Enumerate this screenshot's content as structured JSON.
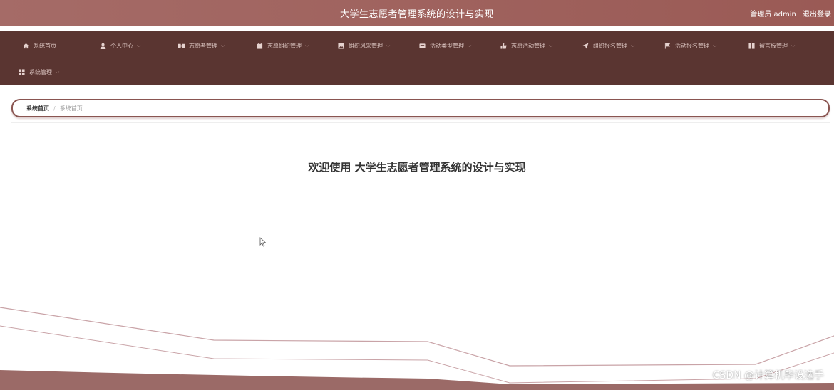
{
  "header": {
    "title": "大学生志愿者管理系统的设计与实现",
    "user_label": "管理员 admin",
    "logout_label": "退出登录"
  },
  "nav": {
    "items": [
      {
        "label": "系统首页",
        "icon": "home-icon",
        "has_dropdown": false
      },
      {
        "label": "个人中心",
        "icon": "user-icon",
        "has_dropdown": true
      },
      {
        "label": "志愿者管理",
        "icon": "group-icon",
        "has_dropdown": true
      },
      {
        "label": "志愿组织管理",
        "icon": "calendar-icon",
        "has_dropdown": true
      },
      {
        "label": "组织风采管理",
        "icon": "image-icon",
        "has_dropdown": true
      },
      {
        "label": "活动类型管理",
        "icon": "card-icon",
        "has_dropdown": true
      },
      {
        "label": "志愿活动管理",
        "icon": "thumb-icon",
        "has_dropdown": true
      },
      {
        "label": "组织报名管理",
        "icon": "send-icon",
        "has_dropdown": true
      },
      {
        "label": "活动报名管理",
        "icon": "flag-icon",
        "has_dropdown": true
      },
      {
        "label": "留言板管理",
        "icon": "grid-icon",
        "has_dropdown": true
      },
      {
        "label": "系统管理",
        "icon": "grid-icon",
        "has_dropdown": true
      }
    ]
  },
  "breadcrumb": {
    "home": "系统首页",
    "separator": "/",
    "current": "系统首页"
  },
  "main": {
    "welcome": "欢迎使用 大学生志愿者管理系统的设计与实现"
  },
  "watermark": "CSDN @计算机毕设选手",
  "colors": {
    "topbar": "#9e605b",
    "navband": "#5a3531",
    "accent": "#8a5551"
  }
}
